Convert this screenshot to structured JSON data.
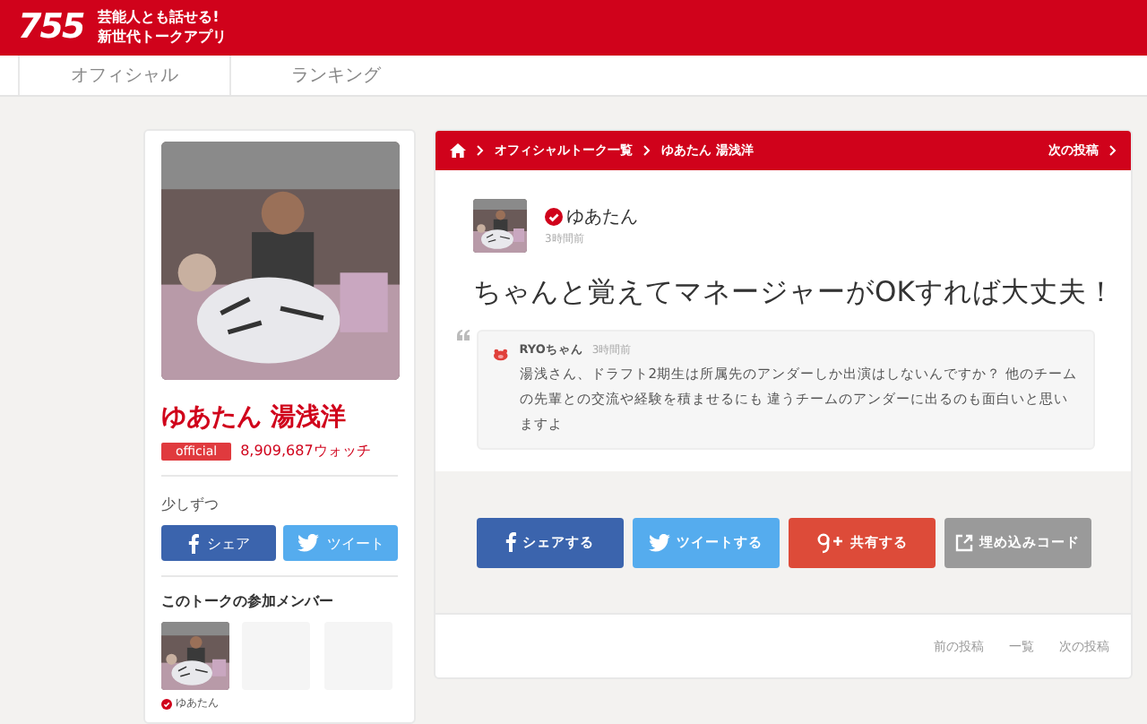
{
  "header": {
    "logo": "755",
    "tagline_lines": [
      "芸能人とも話せる!",
      "新世代トークアプリ"
    ]
  },
  "nav": [
    {
      "label": "オフィシャル",
      "selected": false
    },
    {
      "label": "ランキング",
      "selected": false
    }
  ],
  "profile": {
    "name": "ゆあたん 湯浅洋",
    "badge": "official",
    "watch_count": "8,909,687",
    "watch_unit": "ウォッチ",
    "bio": "少しずつ",
    "share_buttons": [
      {
        "kind": "facebook",
        "label": "シェア"
      },
      {
        "kind": "twitter",
        "label": "ツイート"
      }
    ],
    "members_title": "このトークの参加メンバー",
    "members": [
      {
        "kind": "picture",
        "name": "ゆあたん",
        "verified": true
      },
      {
        "kind": "empty"
      },
      {
        "kind": "empty"
      }
    ]
  },
  "breadcrumb": {
    "items": [
      "オフィシャルトーク一覧",
      "ゆあたん 湯浅洋"
    ],
    "next": "次の投稿"
  },
  "post": {
    "author": "ゆあたん",
    "verified": true,
    "time": "3時間前",
    "text": "ちゃんと覚えてマネージャーがOKすれば大丈夫！",
    "quote": {
      "author": "RYOちゃん",
      "time": "3時間前",
      "text": "湯浅さん、ドラフト2期生は所属先のアンダーしか出演はしないんですか？ 他のチームの先輩との交流や経験を積ませるにも 違うチームのアンダーに出るのも面白いと思いますよ"
    }
  },
  "actions": [
    {
      "kind": "facebook",
      "label": "シェアする"
    },
    {
      "kind": "twitter",
      "label": "ツイートする"
    },
    {
      "kind": "google",
      "label": "共有する"
    },
    {
      "kind": "embed",
      "label": "埋め込みコード"
    }
  ],
  "pager": [
    "前の投稿",
    "一覧",
    "次の投稿"
  ]
}
